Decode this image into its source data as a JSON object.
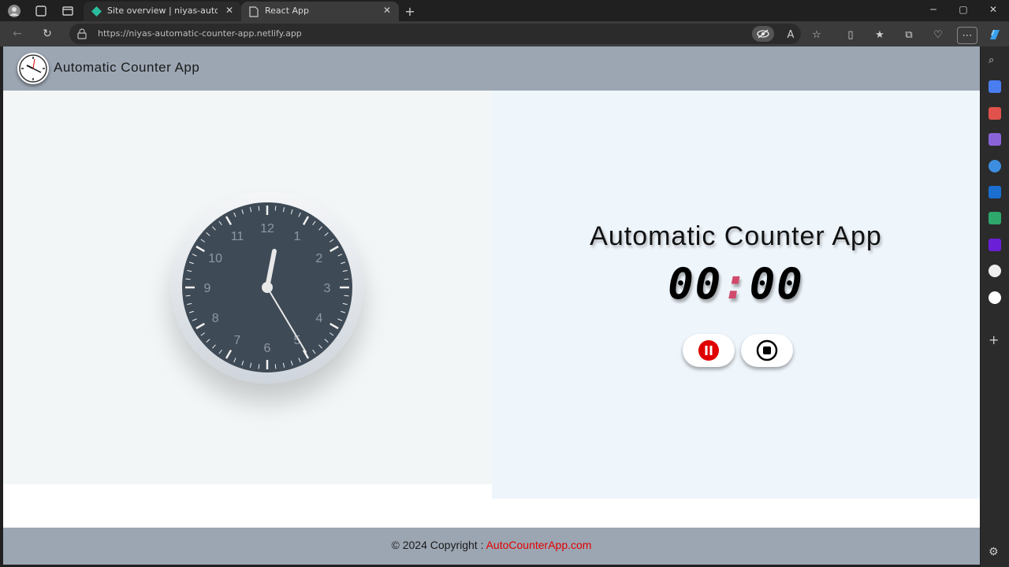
{
  "browser": {
    "tabs": [
      {
        "label": "Site overview | niyas-automatic-",
        "active": false
      },
      {
        "label": "React App",
        "active": true
      }
    ],
    "url": "https://niyas-automatic-counter-app.netlify.app"
  },
  "header": {
    "brand": "Automatic Counter App"
  },
  "main": {
    "title": "Automatic Counter App",
    "timer": {
      "minutes": "00",
      "separator": ":",
      "seconds": "00"
    },
    "clock": {
      "numerals": [
        "12",
        "1",
        "2",
        "3",
        "4",
        "5",
        "6",
        "7",
        "8",
        "9",
        "10",
        "11"
      ]
    }
  },
  "footer": {
    "copyright": "© 2024 Copyright : ",
    "link": "AutoCounterApp.com"
  },
  "colors": {
    "header_bg": "#9ca6b3",
    "accent_red": "#e00000",
    "clock_face": "#3e4a56"
  },
  "icons": {
    "pause": "pause-icon",
    "stop": "stop-icon"
  }
}
